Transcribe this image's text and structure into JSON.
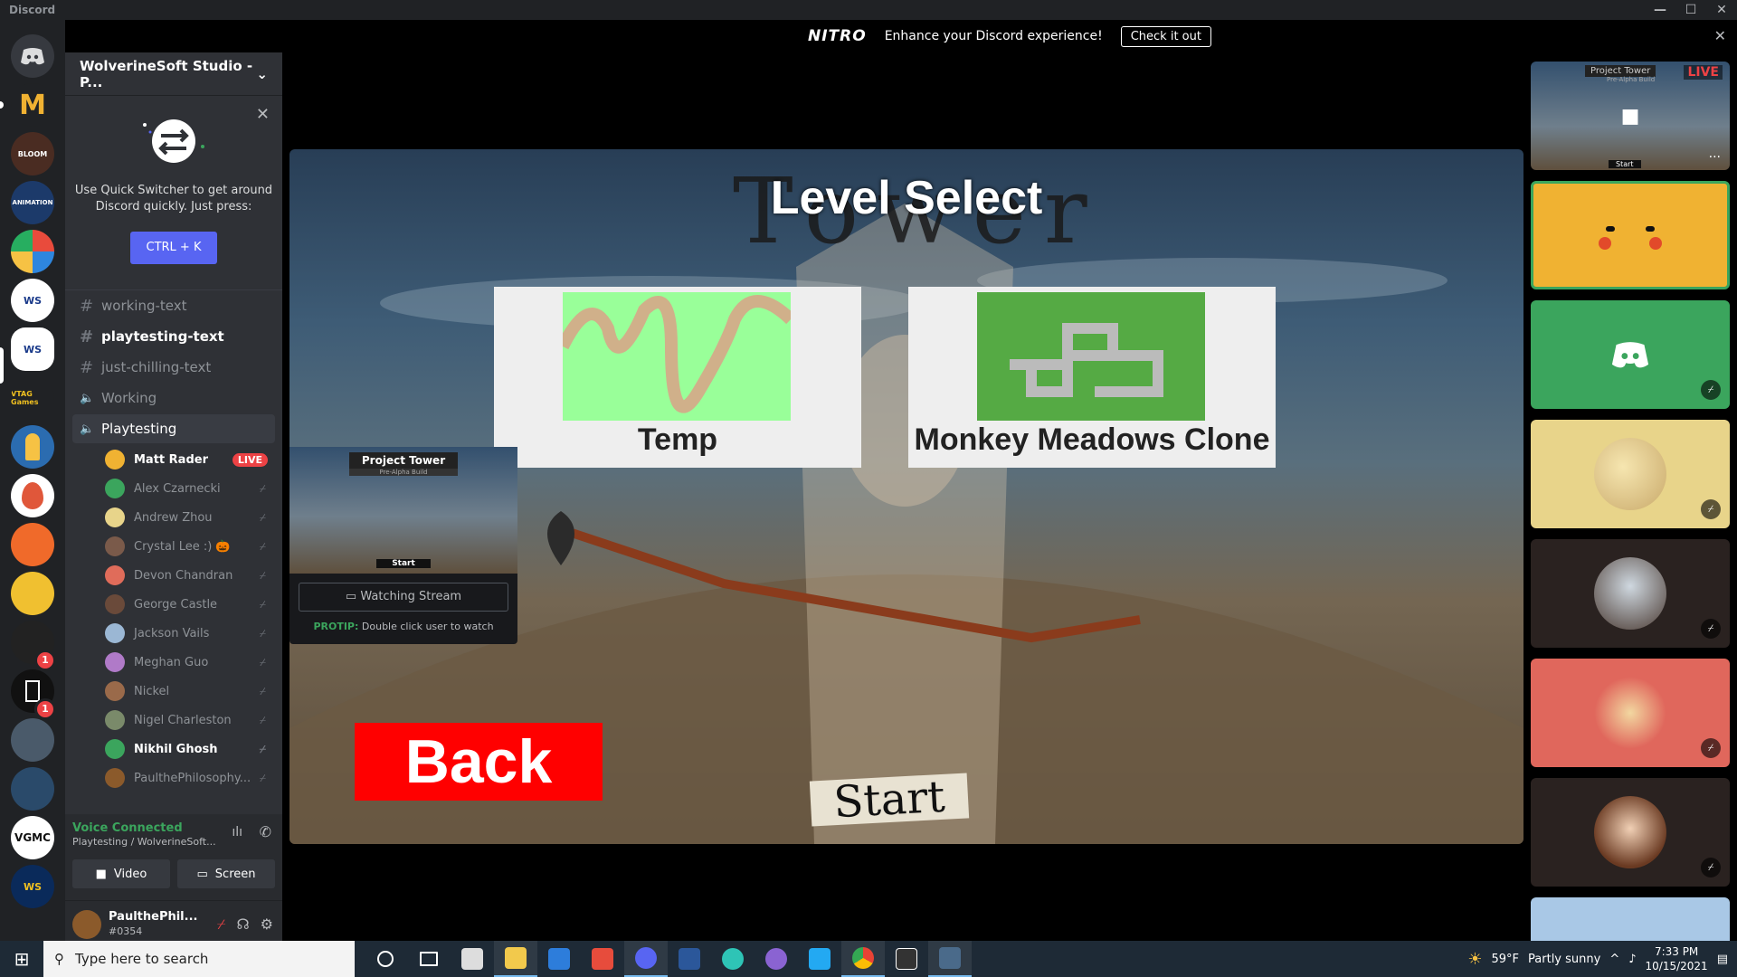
{
  "app": {
    "title": "Discord"
  },
  "window_controls": {
    "minimize": "—",
    "maximize": "☐",
    "close": "✕"
  },
  "nitro": {
    "logo": "NITRO",
    "message": "Enhance your Discord experience!",
    "cta": "Check it out",
    "close": "✕"
  },
  "server": {
    "name": "WolverineSoft Studio - P...",
    "dropdown": "⌄"
  },
  "quick_switcher": {
    "message": "Use Quick Switcher to get around Discord quickly. Just press:",
    "shortcut": "CTRL + K",
    "close": "✕"
  },
  "channels": [
    {
      "symbol": "#",
      "name": "working-text"
    },
    {
      "symbol": "#",
      "name": "playtesting-text"
    },
    {
      "symbol": "#",
      "name": "just-chilling-text"
    },
    {
      "symbol": "🔈",
      "name": "Working"
    },
    {
      "symbol": "🔈",
      "name": "Playtesting"
    }
  ],
  "voice_users": [
    {
      "name": "Matt Rader",
      "live": "LIVE",
      "color": "#f0b232"
    },
    {
      "name": "Alex Czarnecki",
      "color": "#3ba55d"
    },
    {
      "name": "Andrew Zhou",
      "color": "#e8d48a"
    },
    {
      "name": "Crystal Lee :) 🎃",
      "color": "#7a5a4a"
    },
    {
      "name": "Devon Chandran",
      "color": "#e06c5a"
    },
    {
      "name": "George Castle",
      "color": "#6a4a3a"
    },
    {
      "name": "Jackson Vails",
      "color": "#9bb7d4"
    },
    {
      "name": "Meghan Guo",
      "color": "#b07ac8"
    },
    {
      "name": "Nickel",
      "color": "#9a6a4a"
    },
    {
      "name": "Nigel Charleston",
      "color": "#7a8a6a"
    },
    {
      "name": "Nikhil Ghosh",
      "color": "#3ba55d"
    },
    {
      "name": "PaulthePhilosophy...",
      "color": "#8b5a2b"
    }
  ],
  "voice_panel": {
    "status": "Voice Connected",
    "location": "Playtesting / WolverineSoft...",
    "video": "Video",
    "screen": "Screen"
  },
  "user_panel": {
    "name": "PaulthePhil...",
    "tag": "#0354"
  },
  "game": {
    "tower_text": "Tower",
    "title": "Level Select",
    "levels": [
      "Temp",
      "Monkey Meadows Clone"
    ],
    "back": "Back",
    "start": "Start"
  },
  "stream_popout": {
    "title": "Project Tower",
    "subtitle": "Pre-Alpha Build",
    "start": "Start",
    "button": "Watching Stream",
    "tip_label": "PROTIP:",
    "tip_text": "Double click user to watch"
  },
  "tiles": {
    "live": "LIVE",
    "stream_title": "Project Tower",
    "stream_sub": "Pre-Alpha Build",
    "stream_start": "Start"
  },
  "guild_badges": [
    "1",
    "1"
  ],
  "guild_labels": [
    "M",
    "BLOOM",
    "ANIMATION",
    "",
    "WS",
    "WS",
    "VTAG Games",
    "",
    "",
    "",
    "",
    "",
    "",
    "",
    "",
    "VGMC",
    "WS"
  ],
  "taskbar": {
    "search_placeholder": "Type here to search",
    "weather_temp": "59°F",
    "weather_text": "Partly sunny",
    "time": "7:33 PM",
    "date": "10/15/2021"
  },
  "colors": {
    "accent": "#5865f2",
    "green": "#3ba55d",
    "red": "#ed4245",
    "back_button": "#ff0000",
    "card_green": "#99ff99",
    "card_green2": "#55aa44"
  }
}
